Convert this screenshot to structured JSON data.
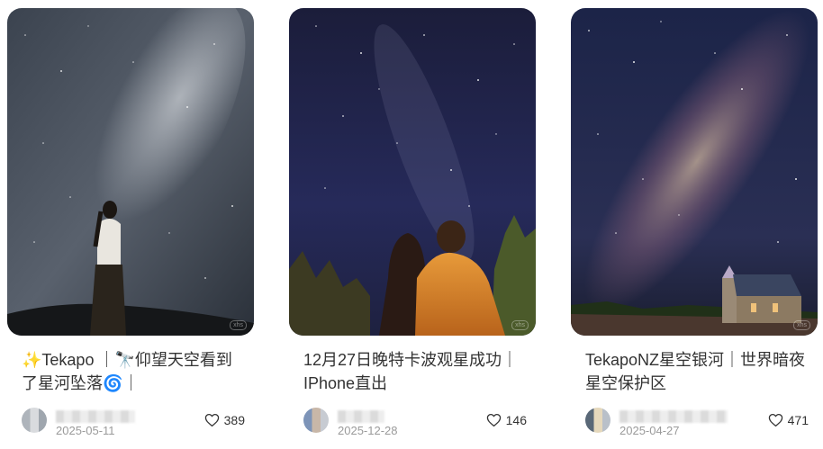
{
  "cards": [
    {
      "title_emoji_1": "✨",
      "title": "Tekapo ｜🔭仰望天空看到了星河坠落🌀｜",
      "date": "2025-05-11",
      "likes": "389"
    },
    {
      "title": "12月27日晚特卡波观星成功｜IPhone直出",
      "date": "2025-12-28",
      "likes": "146"
    },
    {
      "title": "TekapoNZ星空银河｜世界暗夜星空保护区",
      "date": "2025-04-27",
      "likes": "471"
    }
  ],
  "icons": {
    "like": "heart-outline-icon",
    "avatar": "user-avatar"
  },
  "colors": {
    "title_text": "#333333",
    "date_text": "#9a9a9a",
    "background": "#ffffff"
  }
}
